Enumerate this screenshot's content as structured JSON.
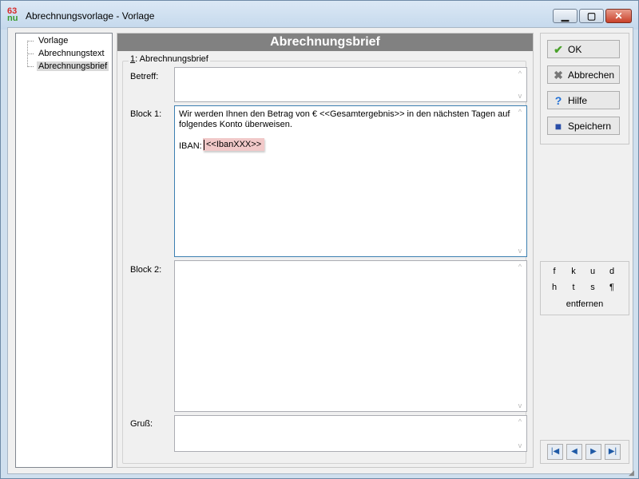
{
  "window": {
    "title": "Abrechnungsvorlage - Vorlage",
    "app_icon_top": "63",
    "app_icon_bottom": "nu",
    "minimize_glyph": "▁",
    "maximize_glyph": "▢",
    "close_glyph": "✕"
  },
  "tree": {
    "items": [
      {
        "label": "Vorlage"
      },
      {
        "label": "Abrechnungstext"
      },
      {
        "label": "Abrechnungsbrief",
        "selected": true
      }
    ]
  },
  "main": {
    "header": "Abrechnungsbrief",
    "group_title_num": "1",
    "group_title_rest": ": Abrechnungsbrief",
    "fields": {
      "betreff_label": "Betreff:",
      "betreff_value": "",
      "block1_label": "Block 1:",
      "block1_text": "Wir werden Ihnen den Betrag von € <<Gesamtergebnis>> in den nächsten Tagen auf folgendes Konto überweisen.",
      "block1_iban_label": "IBAN:",
      "block1_iban_token": "<<IbanXXX>>",
      "block2_label": "Block 2:",
      "block2_value": "",
      "gruss_label": "Gruß:",
      "gruss_value": ""
    },
    "scroll_up": "^",
    "scroll_down": "v"
  },
  "actions": {
    "ok_label": "OK",
    "cancel_label": "Abbrechen",
    "help_label": "Hilfe",
    "save_label": "Speichern",
    "ok_icon": "✔",
    "cancel_icon": "✖",
    "help_icon": "?",
    "save_icon": "■"
  },
  "format": {
    "row1": [
      "f",
      "k",
      "u",
      "d"
    ],
    "row2": [
      "h",
      "t",
      "s",
      "¶"
    ],
    "remove_label": "entfernen"
  },
  "nav": {
    "first": "|◀",
    "prev": "◀",
    "next": "▶",
    "last": "▶|"
  }
}
